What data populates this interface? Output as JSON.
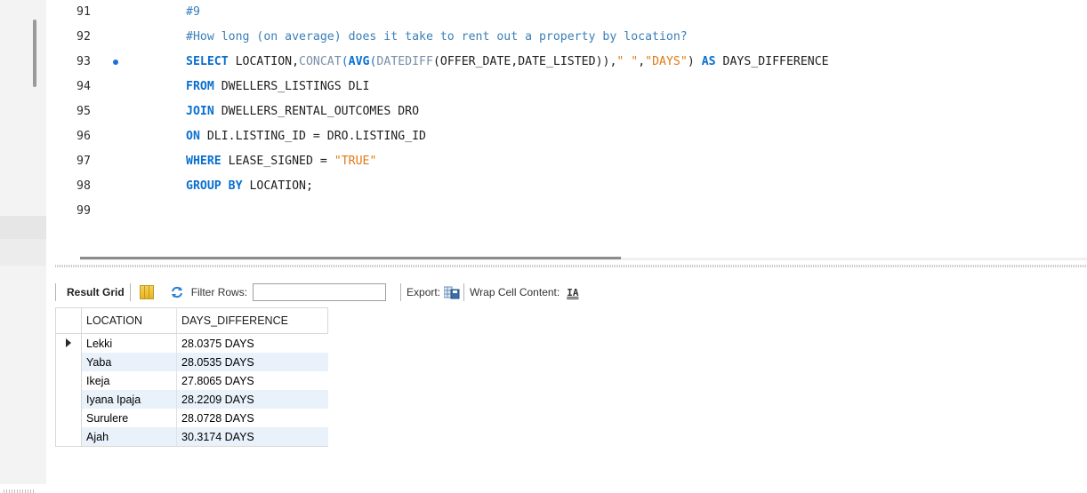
{
  "editor": {
    "lines": [
      {
        "number": "91",
        "text": "#9"
      },
      {
        "number": "92",
        "text": "#How long (on average) does it take to rent out a property by location?"
      },
      {
        "number": "93",
        "text": "SELECT LOCATION,CONCAT(AVG(DATEDIFF(OFFER_DATE,DATE_LISTED)),\" \",\"DAYS\") AS DAYS_DIFFERENCE"
      },
      {
        "number": "94",
        "text": "FROM DWELLERS_LISTINGS DLI"
      },
      {
        "number": "95",
        "text": "JOIN DWELLERS_RENTAL_OUTCOMES DRO"
      },
      {
        "number": "96",
        "text": "ON DLI.LISTING_ID = DRO.LISTING_ID"
      },
      {
        "number": "97",
        "text": "WHERE LEASE_SIGNED = \"TRUE\""
      },
      {
        "number": "98",
        "text": "GROUP BY LOCATION;"
      },
      {
        "number": "99",
        "text": ""
      }
    ],
    "tokens": {
      "select": "SELECT",
      "select_cols": " LOCATION,",
      "concat": "CONCAT",
      "paren_open": "(",
      "avg": "AVG",
      "paren_open2": "(",
      "datediff": "DATEDIFF",
      "datediff_args": "(OFFER_DATE,DATE_LISTED)),",
      "str_space": "\" \"",
      "comma": ",",
      "str_days": "\"DAYS\"",
      "paren_close": ") ",
      "as": "AS",
      "alias": " DAYS_DIFFERENCE",
      "from": "FROM",
      "from_rest": " DWELLERS_LISTINGS DLI",
      "join": "JOIN",
      "join_rest": " DWELLERS_RENTAL_OUTCOMES DRO",
      "on": "ON",
      "on_rest": " DLI.LISTING_ID = DRO.LISTING_ID",
      "where": "WHERE",
      "where_rest": " LEASE_SIGNED = ",
      "str_true": "\"TRUE\"",
      "group_by": "GROUP BY",
      "group_rest": " LOCATION;"
    }
  },
  "toolbar": {
    "result_grid_label": "Result Grid",
    "filter_rows_label": "Filter Rows:",
    "filter_rows_value": "",
    "export_label": "Export:",
    "wrap_label": "Wrap Cell Content:",
    "wrap_icon_glyph": "IA"
  },
  "grid": {
    "columns": [
      "LOCATION",
      "DAYS_DIFFERENCE"
    ],
    "rows": [
      {
        "location": "Lekki",
        "days_difference": "28.0375 DAYS"
      },
      {
        "location": "Yaba",
        "days_difference": "28.0535 DAYS"
      },
      {
        "location": "Ikeja",
        "days_difference": "27.8065 DAYS"
      },
      {
        "location": "Iyana Ipaja",
        "days_difference": "28.2209 DAYS"
      },
      {
        "location": "Surulere",
        "days_difference": "28.0728 DAYS"
      },
      {
        "location": "Ajah",
        "days_difference": "30.3174 DAYS"
      }
    ]
  },
  "colors": {
    "keyword": "#0a6fd0",
    "string": "#e17a14",
    "comment": "#3a7fb8",
    "alt_row": "#e9f1fb"
  }
}
